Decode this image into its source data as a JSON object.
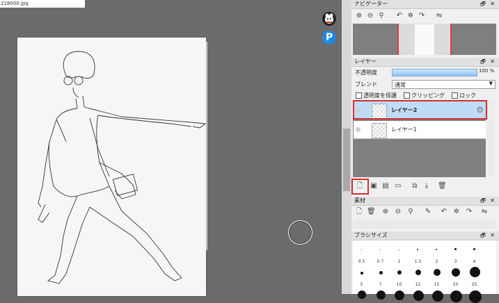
{
  "document_tab": {
    "label": "218000.jpg"
  },
  "navigator": {
    "title": "ナビゲーター",
    "controls": "🗗 ✕"
  },
  "layers": {
    "title": "レイヤー",
    "controls": "🗗 ✕",
    "opacity_label": "不透明度",
    "opacity_value": "100 %",
    "opacity_fraction": 1.0,
    "blend_label": "ブレンド",
    "blend_value": "通常",
    "protect_alpha": "透明度を保護",
    "clipping": "クリッピング",
    "lock": "ロック",
    "items": [
      {
        "name": "レイヤー2",
        "selected": true
      },
      {
        "name": "レイヤー1",
        "selected": false
      }
    ]
  },
  "materials": {
    "title": "素材",
    "controls": "🗗 ✕"
  },
  "brush_size": {
    "title": "ブラシサイズ",
    "controls": "🗗 ✕",
    "row1": [
      "0.5",
      "0.7",
      "1",
      "1.5",
      "2",
      "3",
      "4"
    ],
    "row2": [
      "5",
      "7",
      "10",
      "12",
      "15",
      "20",
      "25"
    ]
  },
  "colors": {
    "highlight": "#d32f2f",
    "selection": "#bfdcf7",
    "opacity_bar": "#8dc3f3"
  }
}
